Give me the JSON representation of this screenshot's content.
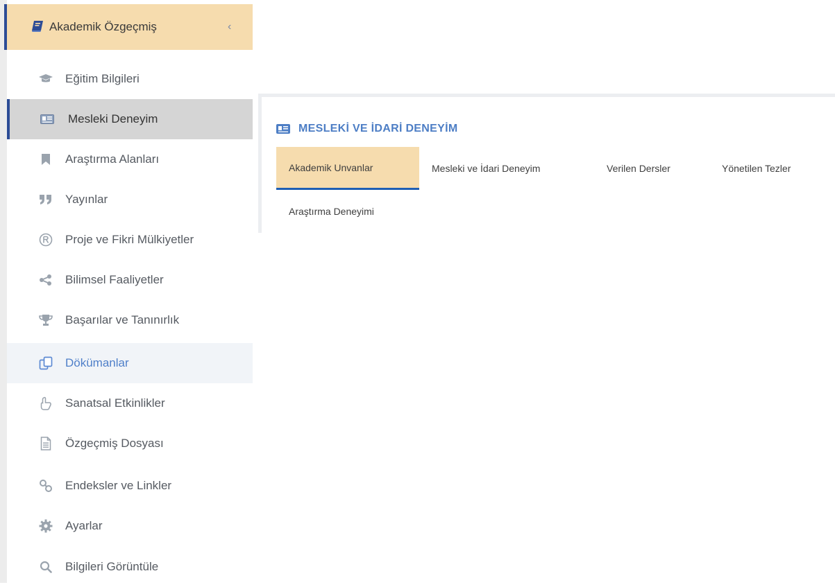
{
  "sidebar": {
    "header": {
      "title": "Akademik Özgeçmiş",
      "icon": "book-icon",
      "chevron": "‹"
    },
    "items": [
      {
        "label": "Eğitim Bilgileri",
        "icon": "graduation-cap-icon"
      },
      {
        "label": "Mesleki Deneyim",
        "icon": "id-card-icon",
        "state": "active"
      },
      {
        "label": "Araştırma Alanları",
        "icon": "bookmark-icon"
      },
      {
        "label": "Yayınlar",
        "icon": "quote-icon"
      },
      {
        "label": "Proje ve Fikri Mülkiyetler",
        "icon": "registered-icon"
      },
      {
        "label": "Bilimsel Faaliyetler",
        "icon": "share-icon"
      },
      {
        "label": "Başarılar ve Tanınırlık",
        "icon": "trophy-icon"
      },
      {
        "label": "Dökümanlar",
        "icon": "documents-icon",
        "state": "hover"
      },
      {
        "label": "Sanatsal Etkinlikler",
        "icon": "hand-pointer-icon"
      },
      {
        "label": "Özgeçmiş Dosyası",
        "icon": "file-icon"
      },
      {
        "label": "Endeksler ve Linkler",
        "icon": "link-icon"
      },
      {
        "label": "Ayarlar",
        "icon": "gear-icon"
      },
      {
        "label": "Bilgileri Görüntüle",
        "icon": "search-icon"
      }
    ]
  },
  "main": {
    "panel_title": "MESLEKİ VE İDARİ DENEYİM",
    "panel_icon": "id-card-icon",
    "tabs": [
      {
        "label": "Akademik Unvanlar",
        "state": "active"
      },
      {
        "label": "Mesleki ve İdari Deneyim"
      },
      {
        "label": "Verilen Dersler"
      },
      {
        "label": "Yönetilen Tezler"
      },
      {
        "label": "Araştırma Deneyimi"
      }
    ]
  },
  "colors": {
    "accent_bar": "#2c4c96",
    "header_bg": "#f6dcae",
    "active_item_bg": "#d5d5d5",
    "title_blue": "#4d7ec5",
    "tab_underline": "#1f5fb4",
    "icon_gray": "#9aa3ad"
  }
}
